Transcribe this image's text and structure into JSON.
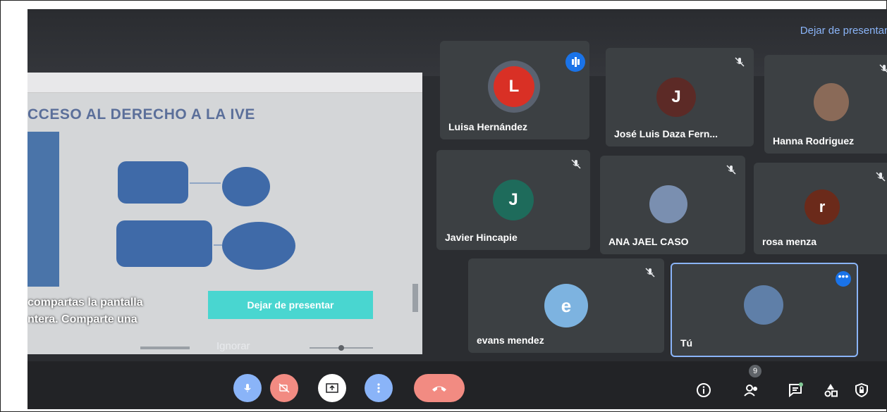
{
  "header": {
    "stop_presenting_link": "Dejar de presentar"
  },
  "presentation": {
    "slide_title": "CCESO AL DERECHO A LA IVE",
    "overlay_line1": "compartas la pantalla",
    "overlay_line2": "ntera. Comparte una",
    "stop_button": "Dejar de presentar",
    "ignore_link": "Ignorar"
  },
  "participants": [
    {
      "name": "Luisa Hernández",
      "initial": "L",
      "color": "#d93025",
      "muted": false,
      "speaking": true
    },
    {
      "name": "José Luis Daza Fern...",
      "initial": "J",
      "color": "#5c2a26",
      "muted": true
    },
    {
      "name": "Hanna Rodriguez",
      "initial": "",
      "color": "#8a6a58",
      "muted": true
    },
    {
      "name": "Javier Hincapie",
      "initial": "J",
      "color": "#1e6b5b",
      "muted": true
    },
    {
      "name": "ANA JAEL CASO",
      "initial": "",
      "color": "#7a8fb0",
      "muted": true
    },
    {
      "name": "rosa menza",
      "initial": "r",
      "color": "#6b2a1a",
      "muted": true
    },
    {
      "name": "evans mendez",
      "initial": "e",
      "color": "#7db3e0",
      "muted": true
    },
    {
      "name": "Tú",
      "initial": "",
      "color": "#5f7fa8",
      "muted": false
    }
  ],
  "controls": {
    "participants_count": "9"
  },
  "colors": {
    "accent": "#1a73e8",
    "hangup": "#f28b82",
    "teal": "#49d6d0"
  }
}
